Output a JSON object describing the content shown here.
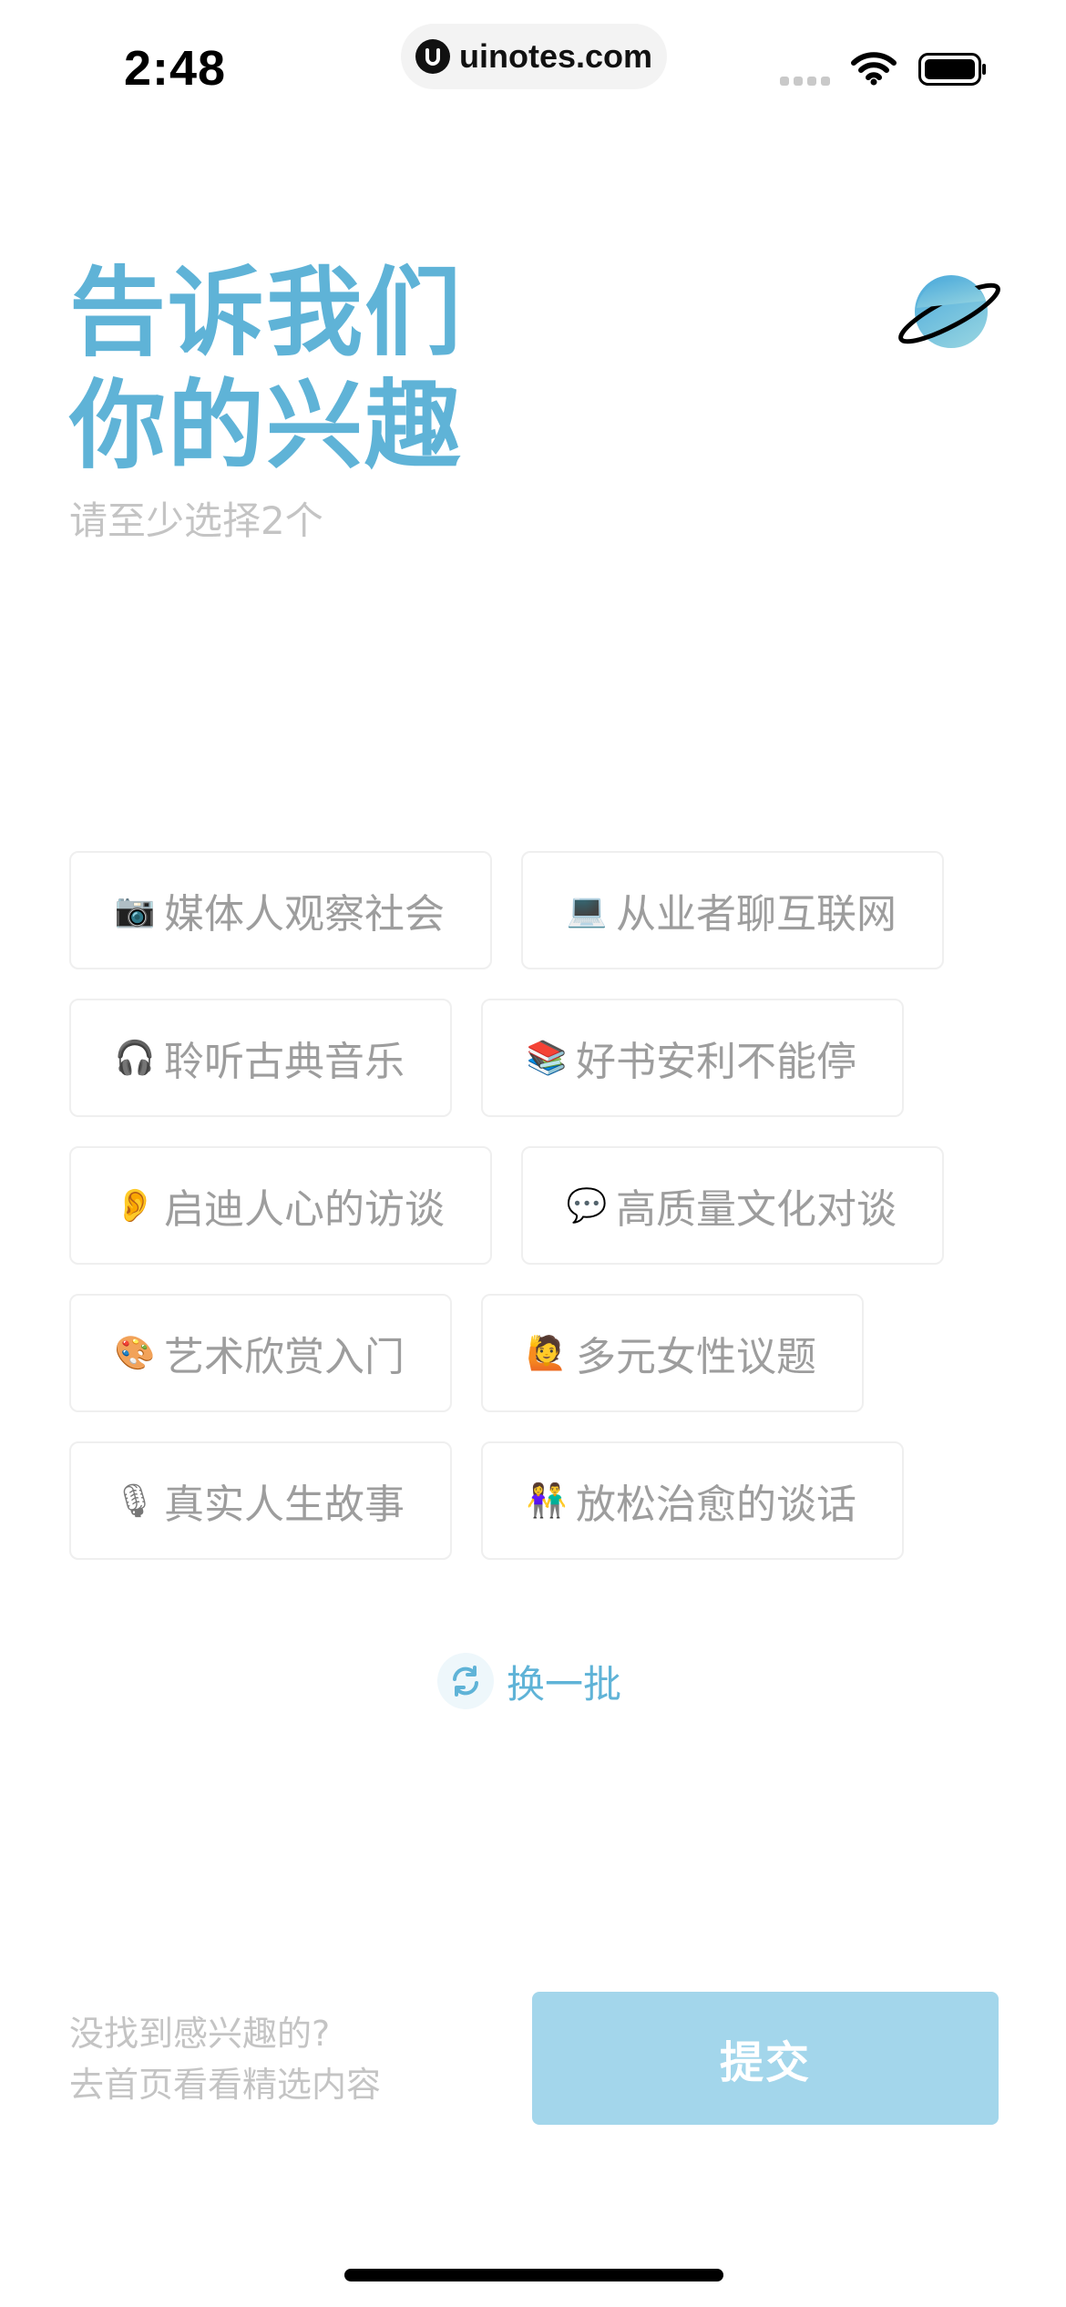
{
  "status_bar": {
    "time": "2:48",
    "url": "uinotes.com"
  },
  "header": {
    "title_line1": "告诉我们",
    "title_line2": "你的兴趣",
    "subtitle": "请至少选择2个"
  },
  "tags": [
    {
      "emoji": "📷",
      "label": "媒体人观察社会",
      "icon": "camera-icon"
    },
    {
      "emoji": "💻",
      "label": "从业者聊互联网",
      "icon": "laptop-icon"
    },
    {
      "emoji": "🎧",
      "label": "聆听古典音乐",
      "icon": "headphones-icon"
    },
    {
      "emoji": "📚",
      "label": "好书安利不能停",
      "icon": "books-icon"
    },
    {
      "emoji": "👂",
      "label": "启迪人心的访谈",
      "icon": "ear-icon"
    },
    {
      "emoji": "💬",
      "label": "高质量文化对谈",
      "icon": "speech-bubble-icon"
    },
    {
      "emoji": "🎨",
      "label": "艺术欣赏入门",
      "icon": "palette-icon"
    },
    {
      "emoji": "🙋",
      "label": "多元女性议题",
      "icon": "woman-icon"
    },
    {
      "emoji": "🎙",
      "label": "真实人生故事",
      "icon": "microphone-icon"
    },
    {
      "emoji": "👫",
      "label": "放松治愈的谈话",
      "icon": "couple-icon"
    }
  ],
  "refresh": {
    "label": "换一批",
    "icon": "refresh-icon"
  },
  "footer": {
    "hint_line1": "没找到感兴趣的?",
    "hint_line2": "去首页看看精选内容",
    "submit_label": "提交"
  },
  "colors": {
    "accent": "#5fb3d7",
    "submit_disabled": "#a3d6eb",
    "muted_text": "#c4c4c4"
  }
}
